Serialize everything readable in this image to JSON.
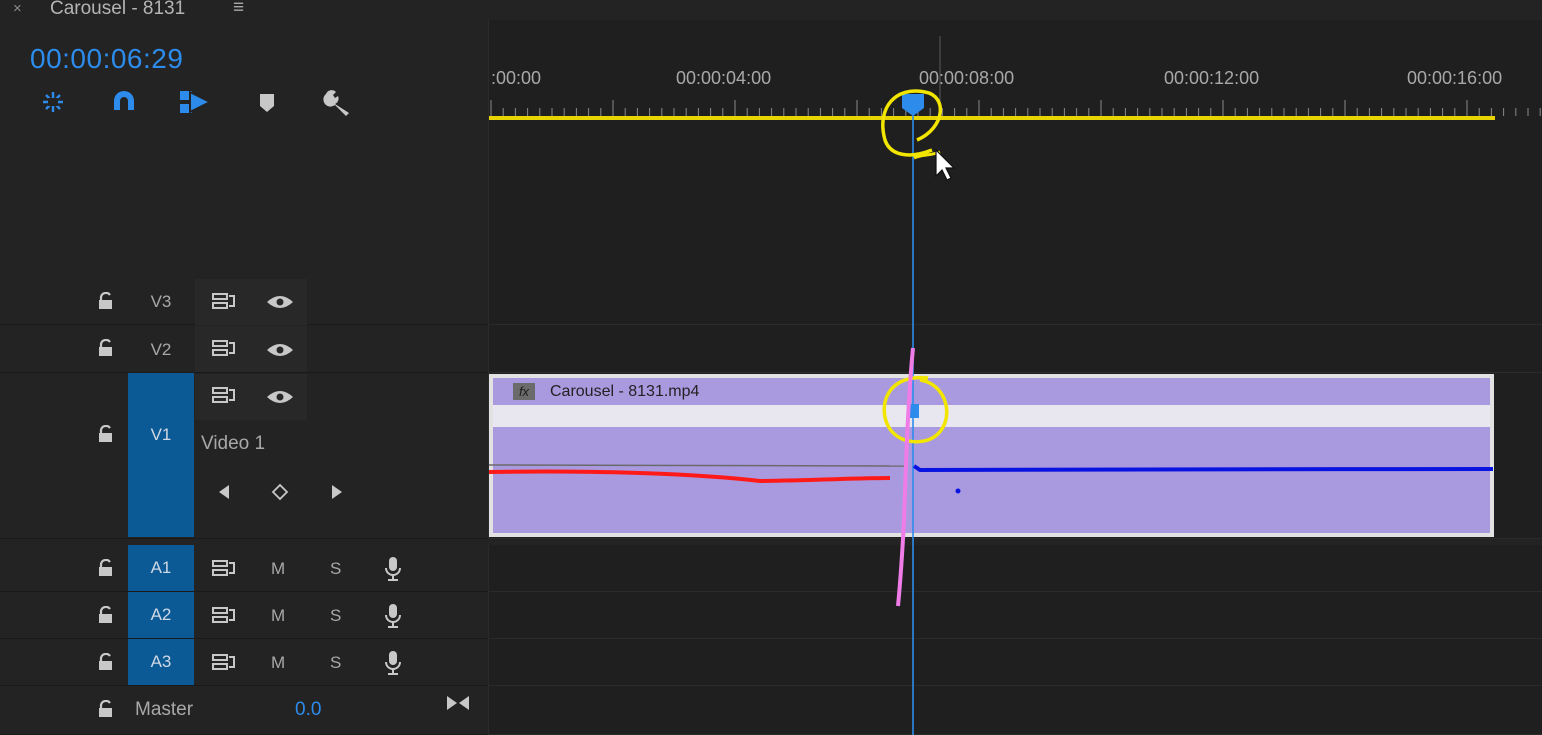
{
  "tab": {
    "close_glyph": "×",
    "title": "Carousel - 8131",
    "menu_glyph": "≡"
  },
  "timecode": "00:00:06:29",
  "toolbar": {
    "tools": [
      {
        "name": "insert-nest-icon"
      },
      {
        "name": "snap-icon"
      },
      {
        "name": "linked-selection-icon"
      },
      {
        "name": "add-marker-icon"
      },
      {
        "name": "wrench-icon"
      }
    ]
  },
  "ruler": {
    "labels": [
      ":00:00",
      "00:00:04:00",
      "00:00:08:00",
      "00:00:12:00",
      "00:00:16:00"
    ],
    "playhead_seconds": 6.97
  },
  "tracks": {
    "v3": {
      "label": "V3"
    },
    "v2": {
      "label": "V2"
    },
    "v1": {
      "label": "V1",
      "name": "Video 1"
    },
    "a1": {
      "label": "A1",
      "mute": "M",
      "solo": "S"
    },
    "a2": {
      "label": "A2",
      "mute": "M",
      "solo": "S"
    },
    "a3": {
      "label": "A3",
      "mute": "M",
      "solo": "S"
    },
    "master": {
      "label": "Master",
      "value": "0.0"
    }
  },
  "clip": {
    "fx_label": "fx",
    "name": "Carousel - 8131.mp4"
  },
  "colors": {
    "accent": "#2d8ceb",
    "work_area": "#e8d400",
    "clip": "#a99ae0",
    "selected_track": "#0b5a96",
    "annotation_yellow": "#f2e600",
    "annotation_red": "#ff1a1a",
    "annotation_blue": "#0a14e0",
    "annotation_pink": "#f07ce8"
  }
}
